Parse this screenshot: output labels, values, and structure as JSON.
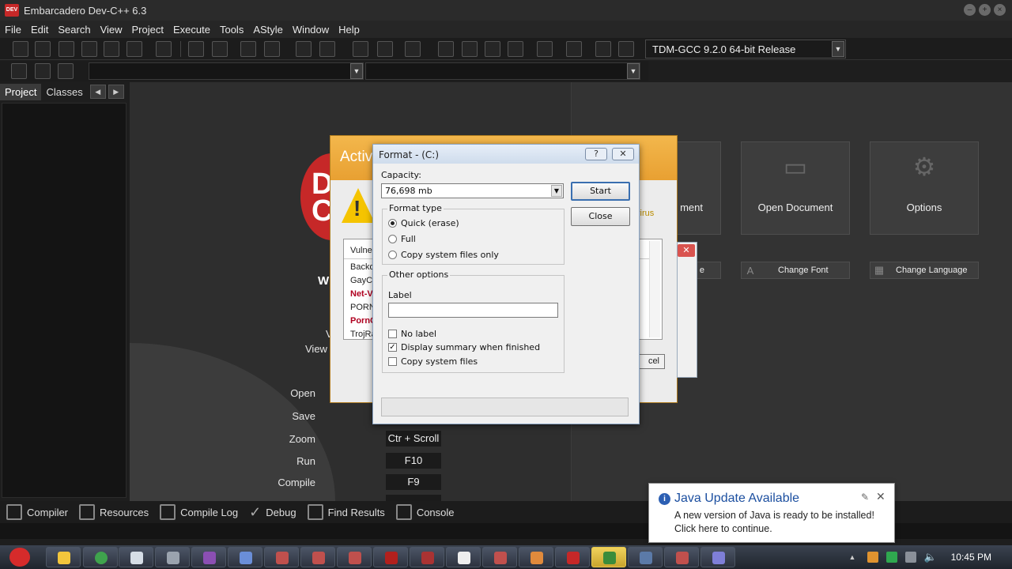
{
  "app": {
    "title": "Embarcadero Dev-C++ 6.3",
    "logo_text": "DEV"
  },
  "menu": [
    "File",
    "Edit",
    "Search",
    "View",
    "Project",
    "Execute",
    "Tools",
    "AStyle",
    "Window",
    "Help"
  ],
  "compiler_select": {
    "value": "TDM-GCC 9.2.0 64-bit Release"
  },
  "left_panel": {
    "tabs": [
      "Project",
      "Classes"
    ]
  },
  "welcome": {
    "heading_fragment": "W",
    "view_fragment": "V",
    "view_label": "View",
    "shortcuts": [
      {
        "label": "Open",
        "key": ""
      },
      {
        "label": "Save",
        "key": ""
      },
      {
        "label": "Zoom",
        "key": "Ctr + Scroll"
      },
      {
        "label": "Run",
        "key": "F10"
      },
      {
        "label": "Compile",
        "key": "F9"
      }
    ],
    "tiles": [
      {
        "label": "ment",
        "icon": "document-icon"
      },
      {
        "label": "Open Document",
        "icon": "folder-icon"
      },
      {
        "label": "Options",
        "icon": "gear-icon"
      }
    ],
    "small_buttons": [
      {
        "label": "e"
      },
      {
        "label": "Change Font"
      },
      {
        "label": "Change Language"
      }
    ]
  },
  "bg_dialog": {
    "title": "Activ",
    "right_text": "virus",
    "list": [
      {
        "text": "Vulner",
        "red": false
      },
      {
        "text": "Backdo",
        "red": false
      },
      {
        "text": "GayCo",
        "red": false
      },
      {
        "text": "Net-V",
        "red": true
      },
      {
        "text": "PORN",
        "red": false
      },
      {
        "text": "PornC",
        "red": true
      },
      {
        "text": "TrojRa",
        "red": false
      }
    ],
    "cancel_fragment": "cel"
  },
  "format_dialog": {
    "title": "Format -  (C:)",
    "help": "?",
    "capacity_label": "Capacity:",
    "capacity_value": "76,698 mb",
    "start": "Start",
    "close": "Close",
    "format_type": {
      "title": "Format type",
      "options": [
        {
          "label": "Quick (erase)",
          "selected": true
        },
        {
          "label": "Full",
          "selected": false
        },
        {
          "label": "Copy system files only",
          "selected": false
        }
      ]
    },
    "other_options": {
      "title": "Other options",
      "label_caption": "Label",
      "label_value": "",
      "checks": [
        {
          "label": "No label",
          "checked": false
        },
        {
          "label": "Display summary when finished",
          "checked": true
        },
        {
          "label": "Copy system files",
          "checked": false
        }
      ]
    }
  },
  "bottom_tabs": [
    {
      "label": "Compiler",
      "icon": "compiler-icon"
    },
    {
      "label": "Resources",
      "icon": "resources-icon"
    },
    {
      "label": "Compile Log",
      "icon": "compile-log-icon"
    },
    {
      "label": "Debug",
      "icon": "debug-icon"
    },
    {
      "label": "Find Results",
      "icon": "find-results-icon"
    },
    {
      "label": "Console",
      "icon": "console-icon"
    }
  ],
  "java_popup": {
    "title": "Java Update Available",
    "message": "A new version of Java is ready to be installed! Click here to continue."
  },
  "taskbar": {
    "clock": "10:45 PM",
    "apps": [
      "folder",
      "chrome",
      "notepad",
      "settings",
      "app-purple",
      "app-blue",
      "app-red-1",
      "app-red-2",
      "app-red-3",
      "app-red-4",
      "flash",
      "app-red-5",
      "app-white",
      "app-red-6",
      "app-orange",
      "devcpp",
      "shield",
      "explorer",
      "app-car",
      "app-multi"
    ]
  },
  "colors": {
    "accent": "#c62828",
    "dialog_header": "#f0a938",
    "java_title": "#1c4fa0"
  }
}
